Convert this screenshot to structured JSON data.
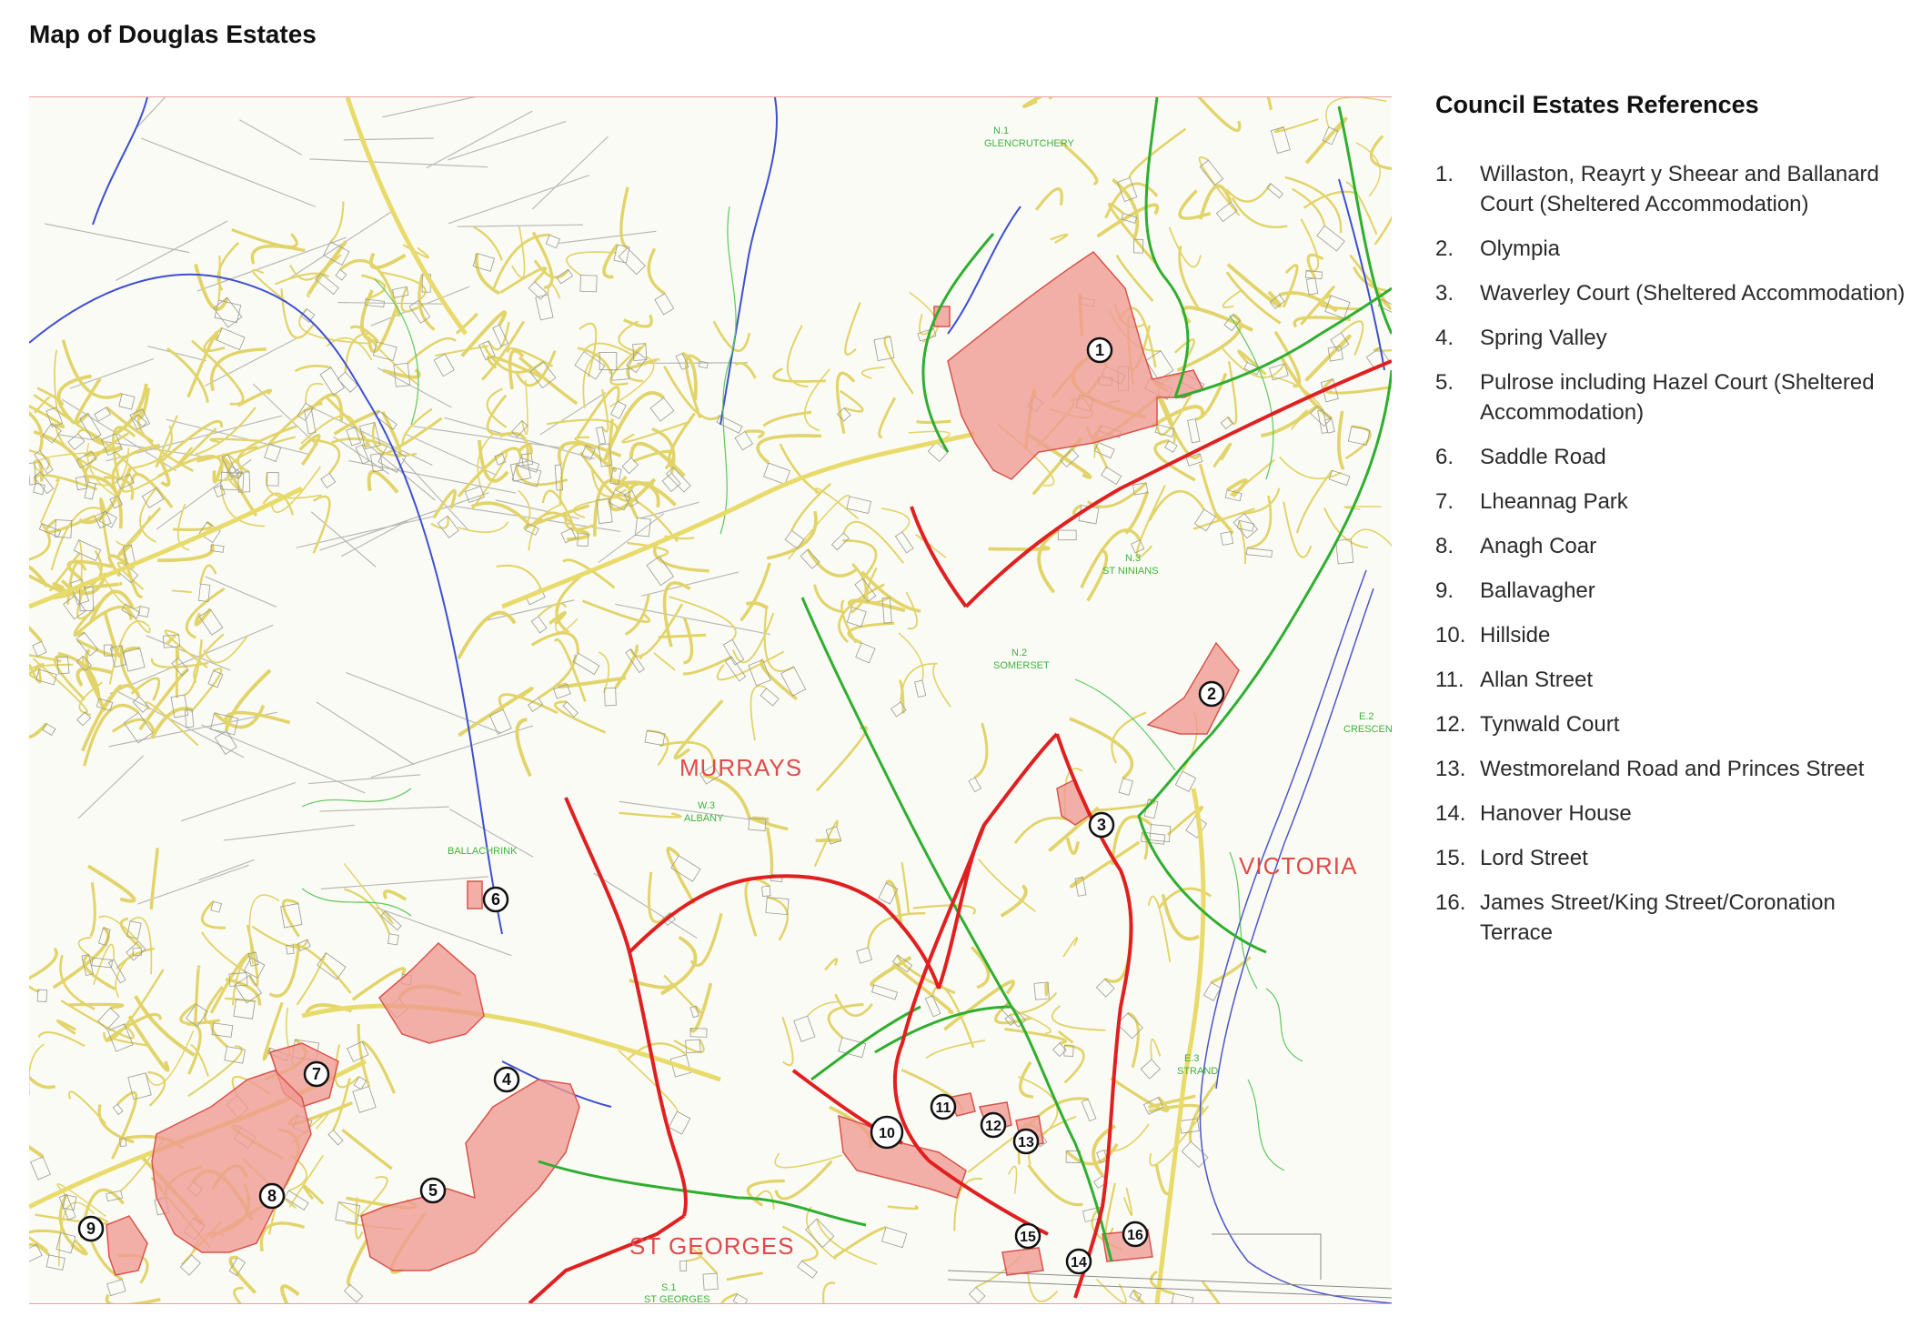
{
  "title": "Map of Douglas Estates",
  "legend": {
    "title": "Council Estates References",
    "items": [
      {
        "num": "1.",
        "name": "Willaston, Reayrt y Sheear and Ballanard Court (Sheltered Accommodation)"
      },
      {
        "num": "2.",
        "name": "Olympia"
      },
      {
        "num": "3.",
        "name": "Waverley Court (Sheltered Accommodation)"
      },
      {
        "num": "4.",
        "name": "Spring Valley"
      },
      {
        "num": "5.",
        "name": "Pulrose including Hazel Court (Sheltered Accommodation)"
      },
      {
        "num": "6.",
        "name": "Saddle Road"
      },
      {
        "num": "7.",
        "name": "Lheannag Park"
      },
      {
        "num": "8.",
        "name": "Anagh Coar"
      },
      {
        "num": "9.",
        "name": "Ballavagher"
      },
      {
        "num": "10.",
        "name": "Hillside"
      },
      {
        "num": "11.",
        "name": "Allan Street"
      },
      {
        "num": "12.",
        "name": "Tynwald Court"
      },
      {
        "num": "13.",
        "name": "Westmoreland Road and Princes Street"
      },
      {
        "num": "14.",
        "name": "Hanover House"
      },
      {
        "num": "15.",
        "name": "Lord Street"
      },
      {
        "num": "16.",
        "name": "James Street/King Street/Coronation Terrace"
      }
    ]
  },
  "map": {
    "area_labels": [
      {
        "text": "MURRAYS",
        "style": "large"
      },
      {
        "text": "VICTORIA",
        "style": "large"
      },
      {
        "text": "ST GEORGES",
        "style": "large"
      },
      {
        "text": "N.1",
        "style": "small"
      },
      {
        "text": "GLENCRUTCHERY",
        "style": "small"
      },
      {
        "text": "N.3",
        "style": "small"
      },
      {
        "text": "ST NINIANS",
        "style": "small"
      },
      {
        "text": "N.2",
        "style": "small"
      },
      {
        "text": "SOMERSET",
        "style": "small"
      },
      {
        "text": "W.3",
        "style": "small"
      },
      {
        "text": "ALBANY",
        "style": "small"
      },
      {
        "text": "BALLACHRINK",
        "style": "small"
      },
      {
        "text": "E.2",
        "style": "small"
      },
      {
        "text": "CRESCENT",
        "style": "small"
      },
      {
        "text": "E.3",
        "style": "small"
      },
      {
        "text": "STRAND",
        "style": "small"
      },
      {
        "text": "S.1",
        "style": "small"
      },
      {
        "text": "ST GEORGES",
        "style": "small"
      }
    ],
    "markers": [
      "1",
      "2",
      "3",
      "4",
      "5",
      "6",
      "7",
      "8",
      "9",
      "10",
      "11",
      "12",
      "13",
      "14",
      "15",
      "16"
    ],
    "colors": {
      "estate_fill": "#f09a92",
      "estate_stroke": "#d9534a",
      "ward_boundary_red": "#e02020",
      "ward_boundary_green": "#2fae2f",
      "road": "#e8d96a",
      "river": "#3d4fd0",
      "contour": "#5cc85c",
      "label_red": "#e04a4a",
      "label_green": "#3cb43c"
    }
  }
}
